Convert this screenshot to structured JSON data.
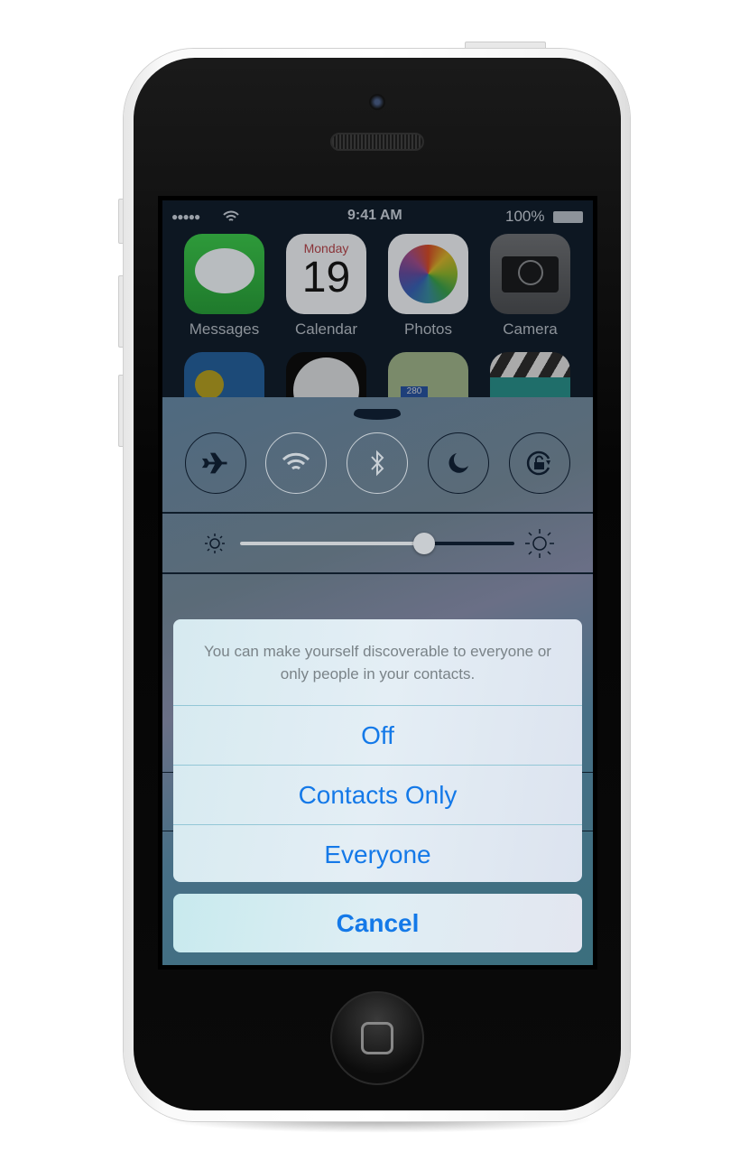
{
  "status_bar": {
    "signal": "●●●●●",
    "time": "9:41 AM",
    "battery": "100%"
  },
  "home_apps": [
    {
      "label": "Messages",
      "icon": "messages-icon"
    },
    {
      "label": "Calendar",
      "icon": "calendar-icon",
      "day": "Monday",
      "date": "19"
    },
    {
      "label": "Photos",
      "icon": "photos-icon"
    },
    {
      "label": "Camera",
      "icon": "camera-icon"
    }
  ],
  "second_row_partial": {
    "maps_sign": "280"
  },
  "control_center": {
    "toggles": [
      {
        "name": "airplane-mode",
        "on": false
      },
      {
        "name": "wifi",
        "on": true
      },
      {
        "name": "bluetooth",
        "on": true
      },
      {
        "name": "do-not-disturb",
        "on": false
      },
      {
        "name": "rotation-lock",
        "on": false
      }
    ],
    "brightness": 0.67
  },
  "action_sheet": {
    "message": "You can make yourself discoverable to everyone or only people in your contacts.",
    "options": [
      "Off",
      "Contacts Only",
      "Everyone"
    ],
    "cancel": "Cancel",
    "accent": "#1479e8"
  }
}
